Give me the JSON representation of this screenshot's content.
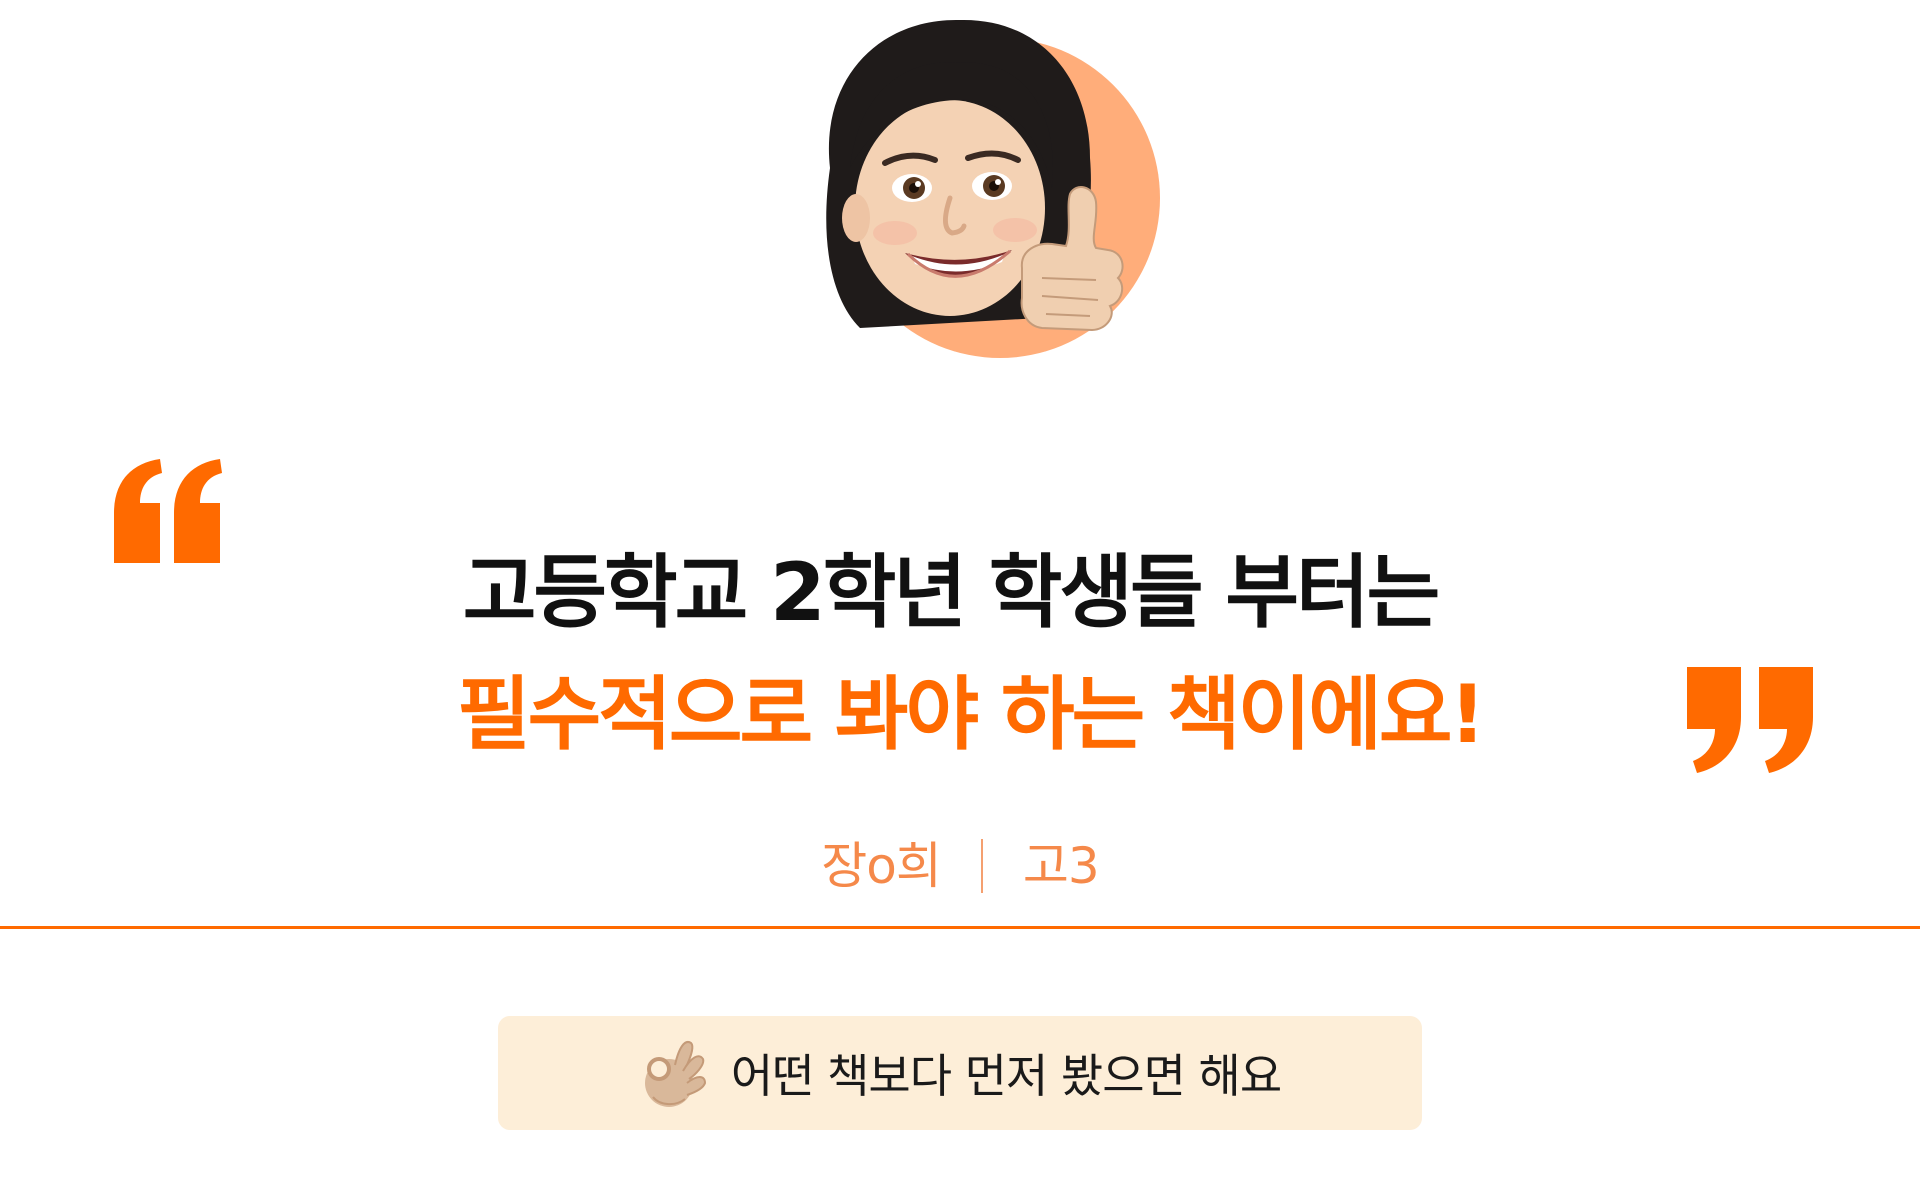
{
  "avatar": {
    "icon": "memoji-thumbs-up-icon",
    "backdrop_color": "#ffad7a"
  },
  "quote_marks": {
    "color": "#ff6a00",
    "open_icon": "open-quote-icon",
    "close_icon": "close-quote-icon"
  },
  "headline": {
    "line1": "고등학교 2학년 학생들 부터는",
    "line2": "필수적으로 봐야 하는 책이에요!",
    "line1_color": "#111111",
    "line2_color": "#ff6a00"
  },
  "attribution": {
    "name": "장o희",
    "grade": "고3",
    "color": "#f5894a"
  },
  "divider_color": "#ff6a00",
  "banner": {
    "icon": "ok-hand-icon",
    "text": "어떤 책보다 먼저 봤으면 해요",
    "background": "#fdeed8"
  }
}
